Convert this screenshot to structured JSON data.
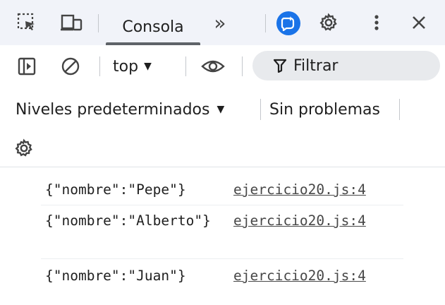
{
  "tabs": {
    "console_label": "Consola",
    "more_label": "»"
  },
  "toolbar": {
    "context_label": "top",
    "filter_placeholder": "Filtrar",
    "levels_label": "Niveles predeterminados",
    "issues_label": "Sin problemas"
  },
  "console": {
    "messages": [
      {
        "text": "{\"nombre\":\"Pepe\"}",
        "source": "ejercicio20.js:4"
      },
      {
        "text": "{\"nombre\":\"Alberto\"}",
        "source": "ejercicio20.js:4"
      },
      {
        "text": "{\"nombre\":\"Juan\"}",
        "source": "ejercicio20.js:4"
      }
    ]
  },
  "colors": {
    "accent": "#1a73e8",
    "toolbar_bg": "#f1f3f9",
    "filter_bg": "#e8eaed",
    "link": "#474747"
  },
  "icons": [
    "inspect-element-icon",
    "device-toolbar-icon",
    "ai-assistant-icon",
    "gear-icon",
    "more-vertical-icon",
    "close-icon",
    "sidebar-toggle-icon",
    "clear-console-icon",
    "eye-icon",
    "filter-icon",
    "caret-down-icon"
  ]
}
